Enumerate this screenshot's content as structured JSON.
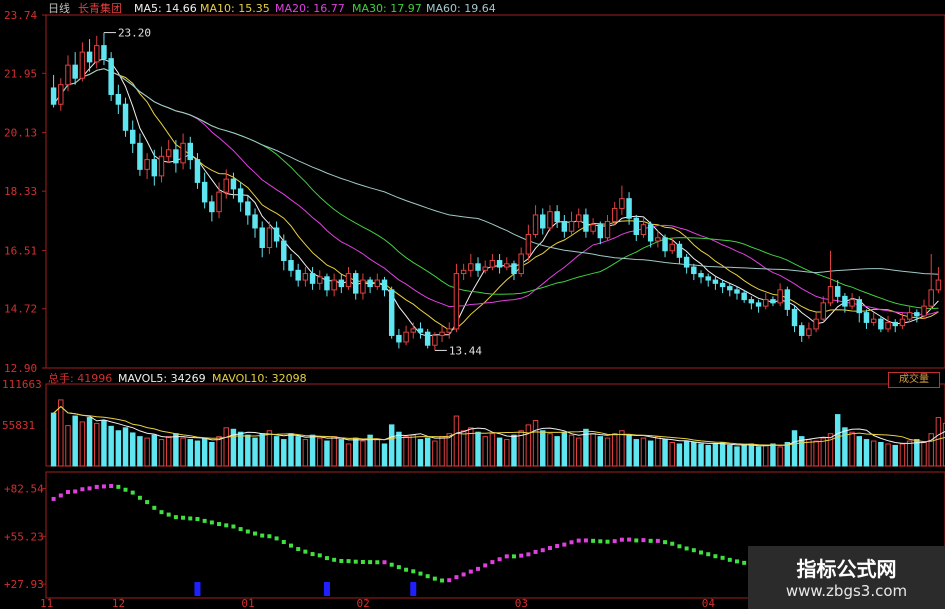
{
  "colors": {
    "background": "#000000",
    "axis_text": "#d03030",
    "frame": "#a02020",
    "up_candle": "#e04040",
    "down_candle": "#5fe6f0",
    "ma5": "#f0f0f0",
    "ma10": "#e8d040",
    "ma20": "#e040e0",
    "ma30": "#40d040",
    "ma60": "#a0c8c8",
    "vol_up": "#e04040",
    "vol_down": "#5fe6f0",
    "osc_up": "#e040e0",
    "osc_down": "#40e040",
    "osc_signal": "#2020ff"
  },
  "header": {
    "period": "日线",
    "stock_name": "长青集团",
    "ma5": "MA5: 14.66",
    "ma10": "MA10: 15.35",
    "ma20": "MA20: 16.77",
    "ma30": "MA30: 17.97",
    "ma60": "MA60: 19.64"
  },
  "volume_header": {
    "title": "总手: 41996",
    "mavol5": "MAVOL5: 34269",
    "mavol10": "MAVOL10: 32098",
    "button": "成交量"
  },
  "watermark": {
    "title": "指标公式网",
    "url": "www.zbgs3.com"
  },
  "chart_data": [
    {
      "type": "candlestick",
      "title": "",
      "y_ticks": [
        "23.74",
        "21.95",
        "20.13",
        "18.33",
        "16.51",
        "14.72",
        "12.90"
      ],
      "ylim": [
        12.9,
        23.74
      ],
      "annotations": [
        {
          "text": "23.20",
          "value": 23.2,
          "index": 7
        },
        {
          "text": "13.44",
          "value": 13.44,
          "index": 53
        }
      ],
      "candles": [
        [
          21.5,
          21.0,
          21.9,
          20.9
        ],
        [
          21.0,
          21.6,
          21.8,
          20.8
        ],
        [
          21.6,
          22.2,
          22.5,
          21.4
        ],
        [
          22.2,
          21.8,
          22.6,
          21.6
        ],
        [
          21.8,
          22.6,
          22.9,
          21.7
        ],
        [
          22.6,
          22.3,
          23.0,
          22.0
        ],
        [
          22.3,
          22.8,
          23.1,
          22.1
        ],
        [
          22.8,
          22.4,
          23.2,
          22.2
        ],
        [
          22.4,
          21.3,
          22.6,
          21.1
        ],
        [
          21.3,
          21.0,
          21.6,
          20.7
        ],
        [
          21.0,
          20.2,
          21.2,
          20.0
        ],
        [
          20.2,
          19.8,
          20.5,
          19.5
        ],
        [
          19.8,
          19.0,
          20.1,
          18.8
        ],
        [
          19.0,
          19.3,
          19.5,
          18.7
        ],
        [
          19.3,
          18.8,
          19.6,
          18.5
        ],
        [
          18.8,
          19.4,
          19.7,
          18.6
        ],
        [
          19.4,
          19.6,
          19.9,
          19.2
        ],
        [
          19.6,
          19.2,
          19.9,
          18.9
        ],
        [
          19.2,
          19.8,
          20.1,
          19.0
        ],
        [
          19.8,
          19.3,
          20.0,
          19.0
        ],
        [
          19.3,
          18.6,
          19.5,
          18.4
        ],
        [
          18.6,
          18.0,
          18.9,
          17.8
        ],
        [
          18.0,
          17.7,
          18.2,
          17.4
        ],
        [
          17.7,
          18.3,
          18.6,
          17.5
        ],
        [
          18.3,
          18.7,
          19.0,
          18.1
        ],
        [
          18.7,
          18.4,
          18.9,
          18.1
        ],
        [
          18.4,
          18.0,
          18.6,
          17.7
        ],
        [
          18.0,
          17.6,
          18.2,
          17.3
        ],
        [
          17.6,
          17.2,
          17.8,
          16.9
        ],
        [
          17.2,
          16.6,
          17.4,
          16.3
        ],
        [
          16.6,
          17.2,
          17.4,
          16.4
        ],
        [
          17.2,
          16.8,
          17.4,
          16.6
        ],
        [
          16.8,
          16.2,
          17.0,
          15.9
        ],
        [
          16.2,
          15.9,
          16.4,
          15.7
        ],
        [
          15.9,
          15.6,
          16.1,
          15.4
        ],
        [
          15.6,
          15.8,
          16.0,
          15.4
        ],
        [
          15.8,
          15.5,
          16.0,
          15.3
        ],
        [
          15.5,
          15.7,
          15.9,
          15.3
        ],
        [
          15.7,
          15.3,
          15.8,
          15.1
        ],
        [
          15.3,
          15.6,
          15.8,
          15.1
        ],
        [
          15.6,
          15.4,
          15.8,
          15.2
        ],
        [
          15.4,
          15.8,
          16.0,
          15.3
        ],
        [
          15.8,
          15.2,
          15.9,
          15.0
        ],
        [
          15.2,
          15.6,
          15.8,
          15.0
        ],
        [
          15.6,
          15.4,
          15.7,
          15.2
        ],
        [
          15.4,
          15.6,
          15.8,
          15.3
        ],
        [
          15.6,
          15.3,
          15.7,
          15.1
        ],
        [
          15.3,
          13.9,
          15.4,
          13.8
        ],
        [
          13.9,
          13.7,
          14.1,
          13.5
        ],
        [
          13.7,
          14.0,
          14.2,
          13.6
        ],
        [
          14.0,
          14.1,
          14.3,
          13.8
        ],
        [
          14.1,
          14.0,
          14.3,
          13.8
        ],
        [
          14.0,
          13.6,
          14.1,
          13.5
        ],
        [
          13.6,
          13.9,
          14.0,
          13.44
        ],
        [
          13.9,
          14.0,
          14.2,
          13.7
        ],
        [
          14.0,
          14.1,
          14.3,
          13.8
        ],
        [
          14.1,
          15.8,
          16.1,
          14.0
        ],
        [
          15.8,
          15.9,
          16.1,
          15.6
        ],
        [
          15.9,
          16.1,
          16.4,
          15.7
        ],
        [
          16.1,
          15.9,
          16.3,
          15.7
        ],
        [
          15.9,
          16.0,
          16.2,
          15.8
        ],
        [
          16.0,
          16.2,
          16.4,
          15.9
        ],
        [
          16.2,
          16.0,
          16.4,
          15.8
        ],
        [
          16.0,
          16.1,
          16.3,
          15.9
        ],
        [
          16.1,
          15.8,
          16.2,
          15.6
        ],
        [
          15.8,
          16.4,
          16.6,
          15.7
        ],
        [
          16.4,
          17.0,
          17.3,
          16.2
        ],
        [
          17.0,
          17.6,
          17.9,
          16.9
        ],
        [
          17.6,
          17.2,
          17.8,
          17.0
        ],
        [
          17.2,
          17.7,
          17.9,
          17.1
        ],
        [
          17.7,
          17.4,
          17.9,
          17.2
        ],
        [
          17.4,
          17.1,
          17.6,
          16.9
        ],
        [
          17.1,
          17.4,
          17.7,
          17.0
        ],
        [
          17.4,
          17.6,
          17.8,
          17.2
        ],
        [
          17.6,
          17.1,
          17.8,
          16.9
        ],
        [
          17.1,
          17.3,
          17.5,
          17.0
        ],
        [
          17.3,
          16.9,
          17.4,
          16.7
        ],
        [
          16.9,
          17.4,
          17.6,
          16.8
        ],
        [
          17.4,
          17.8,
          18.0,
          17.3
        ],
        [
          17.8,
          18.1,
          18.5,
          17.6
        ],
        [
          18.1,
          17.5,
          18.3,
          17.3
        ],
        [
          17.5,
          17.0,
          17.6,
          16.8
        ],
        [
          17.0,
          17.3,
          17.5,
          16.9
        ],
        [
          17.3,
          16.8,
          17.4,
          16.6
        ],
        [
          16.8,
          16.9,
          17.1,
          16.6
        ],
        [
          16.9,
          16.5,
          17.0,
          16.3
        ],
        [
          16.5,
          16.7,
          16.9,
          16.4
        ],
        [
          16.7,
          16.3,
          16.8,
          16.1
        ],
        [
          16.3,
          16.0,
          16.4,
          15.8
        ],
        [
          16.0,
          15.8,
          16.1,
          15.6
        ],
        [
          15.8,
          15.7,
          15.9,
          15.5
        ],
        [
          15.7,
          15.6,
          15.8,
          15.4
        ],
        [
          15.6,
          15.5,
          15.7,
          15.3
        ],
        [
          15.5,
          15.4,
          15.6,
          15.2
        ],
        [
          15.4,
          15.3,
          15.5,
          15.1
        ],
        [
          15.3,
          15.2,
          15.4,
          15.0
        ],
        [
          15.2,
          15.0,
          15.3,
          14.9
        ],
        [
          15.0,
          14.9,
          15.1,
          14.7
        ],
        [
          14.9,
          14.8,
          15.0,
          14.6
        ],
        [
          14.8,
          15.0,
          15.2,
          14.7
        ],
        [
          15.0,
          14.9,
          15.1,
          14.8
        ],
        [
          14.9,
          15.3,
          15.5,
          14.8
        ],
        [
          15.3,
          14.7,
          15.4,
          14.5
        ],
        [
          14.7,
          14.2,
          14.8,
          14.0
        ],
        [
          14.2,
          13.9,
          14.3,
          13.7
        ],
        [
          13.9,
          14.1,
          14.3,
          13.8
        ],
        [
          14.1,
          14.4,
          14.6,
          14.0
        ],
        [
          14.4,
          14.9,
          15.1,
          14.3
        ],
        [
          14.9,
          15.4,
          16.5,
          14.8
        ],
        [
          15.4,
          15.1,
          15.6,
          14.9
        ],
        [
          15.1,
          14.8,
          15.2,
          14.6
        ],
        [
          14.8,
          15.0,
          15.2,
          14.7
        ],
        [
          15.0,
          14.6,
          15.1,
          14.3
        ],
        [
          14.6,
          14.3,
          14.7,
          14.1
        ],
        [
          14.3,
          14.4,
          14.6,
          14.2
        ],
        [
          14.4,
          14.1,
          14.5,
          14.0
        ],
        [
          14.1,
          14.3,
          14.5,
          14.0
        ],
        [
          14.3,
          14.2,
          14.4,
          14.0
        ],
        [
          14.2,
          14.4,
          14.6,
          14.1
        ],
        [
          14.4,
          14.6,
          14.8,
          14.3
        ],
        [
          14.6,
          14.5,
          14.7,
          14.3
        ],
        [
          14.5,
          14.8,
          15.0,
          14.4
        ],
        [
          14.8,
          15.3,
          16.4,
          14.7
        ],
        [
          15.3,
          15.6,
          16.0,
          15.2
        ]
      ]
    },
    {
      "type": "bar",
      "title": "",
      "y_ticks": [
        "111663",
        "55831"
      ],
      "ylim": [
        0,
        111663
      ],
      "series": [
        {
          "name": "MAVOL5",
          "legend": true
        },
        {
          "name": "MAVOL10",
          "legend": true
        }
      ],
      "values": [
        72000,
        90000,
        55000,
        68000,
        60000,
        66000,
        58000,
        62000,
        54000,
        48000,
        52000,
        45000,
        40000,
        38000,
        42000,
        36000,
        40000,
        44000,
        38000,
        36000,
        34000,
        38000,
        32000,
        40000,
        52000,
        50000,
        46000,
        42000,
        38000,
        44000,
        48000,
        40000,
        36000,
        44000,
        40000,
        36000,
        42000,
        38000,
        34000,
        40000,
        36000,
        30000,
        38000,
        34000,
        42000,
        36000,
        30000,
        56000,
        46000,
        40000,
        42000,
        36000,
        38000,
        34000,
        40000,
        44000,
        68000,
        48000,
        52000,
        46000,
        40000,
        44000,
        38000,
        36000,
        42000,
        48000,
        56000,
        62000,
        48000,
        44000,
        40000,
        46000,
        42000,
        38000,
        50000,
        44000,
        40000,
        38000,
        44000,
        48000,
        42000,
        36000,
        38000,
        34000,
        40000,
        36000,
        32000,
        30000,
        34000,
        32000,
        30000,
        28000,
        30000,
        32000,
        28000,
        26000,
        28000,
        30000,
        26000,
        28000,
        30000,
        26000,
        32000,
        48000,
        40000,
        36000,
        34000,
        38000,
        44000,
        70000,
        52000,
        46000,
        40000,
        36000,
        34000,
        32000,
        30000,
        28000,
        30000,
        34000,
        36000,
        32000,
        44000,
        66000,
        58000
      ]
    },
    {
      "type": "scatter",
      "title": "",
      "y_ticks": [
        "82.54",
        "55.23",
        "27.93"
      ],
      "ylim": [
        20,
        92
      ],
      "x_ticks": [
        "11",
        "12",
        "01",
        "02",
        "03",
        "04"
      ]
    }
  ]
}
